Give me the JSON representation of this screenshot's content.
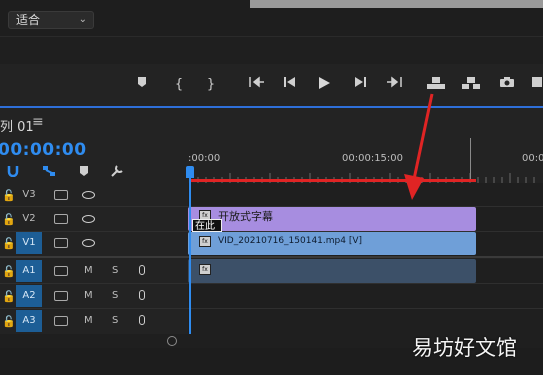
{
  "monitor": {
    "fit_label": "适合"
  },
  "sequence": {
    "title": "列 01",
    "menu_icon": "hamburger-icon",
    "timecode": "00:00:00"
  },
  "ruler": {
    "labels": [
      ":00:00",
      "00:00:15:00",
      "00:00"
    ]
  },
  "tracks": {
    "video": [
      {
        "name": "V3",
        "selected": false
      },
      {
        "name": "V2",
        "selected": false
      },
      {
        "name": "V1",
        "selected": true
      }
    ],
    "audio": [
      {
        "name": "A1",
        "m": "M",
        "s": "S"
      },
      {
        "name": "A2",
        "m": "M",
        "s": "S"
      },
      {
        "name": "A3",
        "m": "M",
        "s": "S"
      }
    ]
  },
  "clips": {
    "subtitle": {
      "label": "开放式字幕",
      "caption_chip": "在此"
    },
    "video": {
      "label": "VID_20210716_150141.mp4 [V]"
    }
  },
  "colors": {
    "accent": "#2f8cf0",
    "subtitle_clip": "#a78de0",
    "video_clip": "#6f9fd8",
    "audio_clip": "#3c5068",
    "annotation": "#e02424"
  },
  "watermark": "易坊好文馆"
}
